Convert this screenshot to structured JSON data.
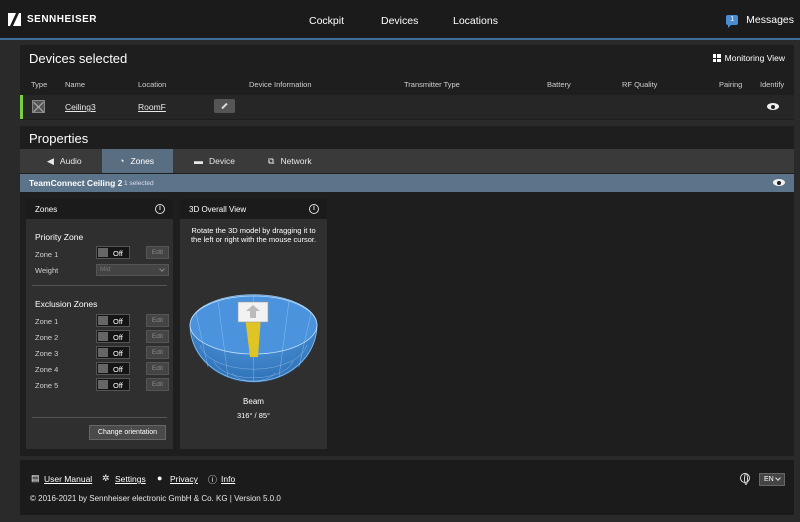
{
  "brand": {
    "name": "SENNHEISER"
  },
  "nav": {
    "items": [
      "Cockpit",
      "Devices",
      "Locations"
    ]
  },
  "messages": {
    "label": "Messages",
    "count": "1"
  },
  "devices_selected": {
    "title": "Devices selected",
    "monitoring_view": "Monitoring View",
    "columns": [
      "Type",
      "Name",
      "Location",
      "Device Information",
      "Transmitter Type",
      "Battery",
      "RF Quality",
      "Pairing",
      "Identify"
    ],
    "row": {
      "name": "Ceiling3",
      "location": "RoomF"
    }
  },
  "properties": {
    "title": "Properties",
    "tabs": [
      "Audio",
      "Zones",
      "Device",
      "Network"
    ],
    "active_tab": "Zones",
    "device_name": "TeamConnect Ceiling 2",
    "selected_count": "1 selected",
    "zones_card": {
      "title": "Zones",
      "priority_zone": {
        "title": "Priority Zone",
        "zone_label": "Zone 1",
        "state": "Off",
        "edit": "Edit",
        "weight_label": "Weight",
        "weight_value": "Mid"
      },
      "exclusion_zones": {
        "title": "Exclusion Zones",
        "zones": [
          {
            "label": "Zone 1",
            "state": "Off",
            "edit": "Edit"
          },
          {
            "label": "Zone 2",
            "state": "Off",
            "edit": "Edit"
          },
          {
            "label": "Zone 3",
            "state": "Off",
            "edit": "Edit"
          },
          {
            "label": "Zone 4",
            "state": "Off",
            "edit": "Edit"
          },
          {
            "label": "Zone 5",
            "state": "Off",
            "edit": "Edit"
          }
        ]
      },
      "change_orientation": "Change orientation"
    },
    "view_card": {
      "title": "3D Overall View",
      "instruction": "Rotate the 3D model by dragging it to the left or right with the mouse cursor.",
      "beam_label": "Beam",
      "beam_value": "316° / 85°"
    }
  },
  "footer": {
    "links": [
      "User Manual",
      "Settings",
      "Privacy",
      "Info"
    ],
    "copyright": "© 2016-2021 by Sennheiser electronic GmbH & Co. KG | Version 5.0.0",
    "language": "EN"
  },
  "colors": {
    "accent": "#3d6f9a",
    "active_tab": "#5a6e82",
    "status_bar": "#7ccf3c",
    "sphere": "#4a90d9",
    "beam": "#e6c619"
  }
}
